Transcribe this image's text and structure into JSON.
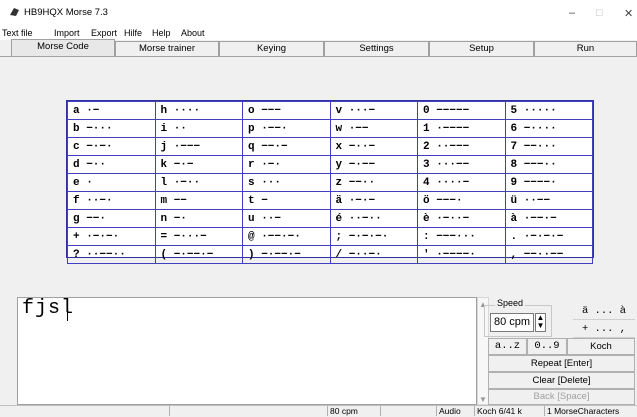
{
  "window": {
    "title": "HB9HQX Morse 7.3",
    "minimize": "–",
    "maximize": "□",
    "close": "✕"
  },
  "menu": [
    "Text file",
    "Import",
    "Export",
    "Hilfe",
    "Help",
    "About"
  ],
  "tabs": [
    "Morse Code",
    "Morse trainer",
    "Keying",
    "Settings",
    "Setup",
    "Run"
  ],
  "active_tab": 0,
  "morse_table": [
    [
      "a ·−",
      "h ····",
      "o −−−",
      "v ···−",
      "0 −−−−−",
      "5 ·····"
    ],
    [
      "b −···",
      "i ··",
      "p ·−−·",
      "w ·−−",
      "1 ·−−−−",
      "6 −····"
    ],
    [
      "c −·−·",
      "j ·−−−",
      "q −−·−",
      "x −··−",
      "2 ··−−−",
      "7 −−···"
    ],
    [
      "d −··",
      "k −·−",
      "r ·−·",
      "y −·−−",
      "3 ···−−",
      "8 −−−··"
    ],
    [
      "e ·",
      "l ·−··",
      "s ···",
      "z −−··",
      "4 ····−",
      "9 −−−−·"
    ],
    [
      "f ··−·",
      "m −−",
      "t −",
      "ä ·−·−",
      "ö −−−·",
      "ü ··−−"
    ],
    [
      "g −−·",
      "n −·",
      "u ··−",
      "é ··−··",
      "è ·−··−",
      "à ·−−·−"
    ],
    [
      "+ ·−·−·",
      "= −···−",
      "@ ·−−·−·",
      "; −·−·−·",
      ": −−−···",
      ". ·−·−·−"
    ],
    [
      "? ··−−··",
      "( −·−−·−",
      ") −·−−·−",
      "/ −··−·",
      "' ·−−−−·",
      ", −−··−−"
    ]
  ],
  "input_text": "fjsl",
  "speed": {
    "label": "Speed",
    "value": "80 cpm",
    "up": "▲",
    "down": "▼"
  },
  "buttons": {
    "a_umlaut": "ä ... à",
    "plus": "+ ... ,",
    "az": "a..z",
    "digits": "0..9",
    "koch": "Koch",
    "repeat": "Repeat  [Enter]",
    "clear": "Clear  [Delete]",
    "back": "Back  [Space]"
  },
  "status": {
    "speed": "80 cpm",
    "audio": "Audio",
    "koch": "Koch 6/41 k",
    "chars": "1 MorseCharacters"
  }
}
